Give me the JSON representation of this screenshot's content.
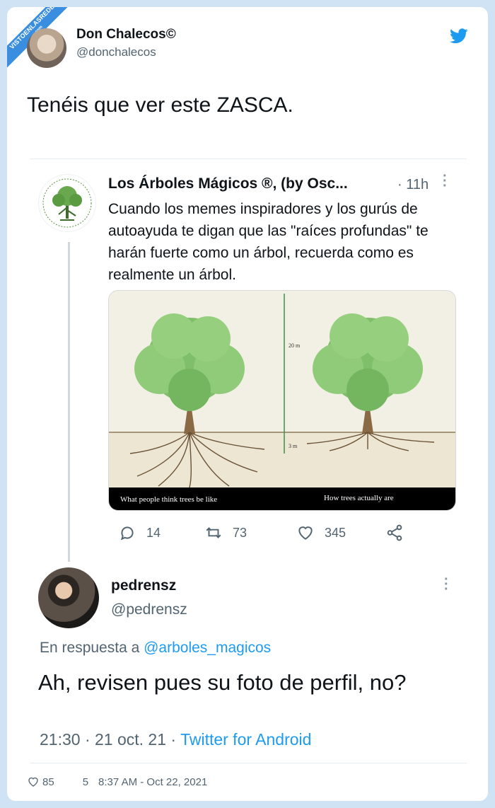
{
  "watermark": {
    "line1": "VISTOENLASREDES",
    "line2": ".com"
  },
  "tweet": {
    "author_name": "Don Chalecos©",
    "author_handle": "@donchalecos",
    "text": "Tenéis que ver este ZASCA.",
    "icon": "twitter-bird-icon"
  },
  "quoted": {
    "author_name": "Los Árboles Mágicos ®, (by Osc...",
    "time": "· 11h",
    "text": "Cuando los memes inspiradores y los gurús de autoayuda te digan que las \"raíces profundas\" te harán fuerte como un árbol, recuerda como es realmente un árbol.",
    "image": {
      "caption_left": "What people think trees be like",
      "caption_right": "How trees actually are",
      "label_height": "20 m",
      "label_depth": "3 m"
    },
    "actions": {
      "replies": "14",
      "retweets": "73",
      "likes": "345"
    }
  },
  "reply": {
    "author_name": "pedrensz",
    "author_handle": "@pedrensz",
    "reply_prefix": "En respuesta a",
    "reply_target": "@arboles_magicos",
    "text": "Ah, revisen pues su foto de perfil, no?",
    "timestamp": "21:30 · 21 oct. 21 ·",
    "source": "Twitter for Android"
  },
  "footer": {
    "likes": "85",
    "replies": "5",
    "timestamp": "8:37 AM - Oct 22, 2021"
  },
  "colors": {
    "accent": "#1d9bf0",
    "muted": "#536471",
    "background": "#cfe3f5"
  }
}
